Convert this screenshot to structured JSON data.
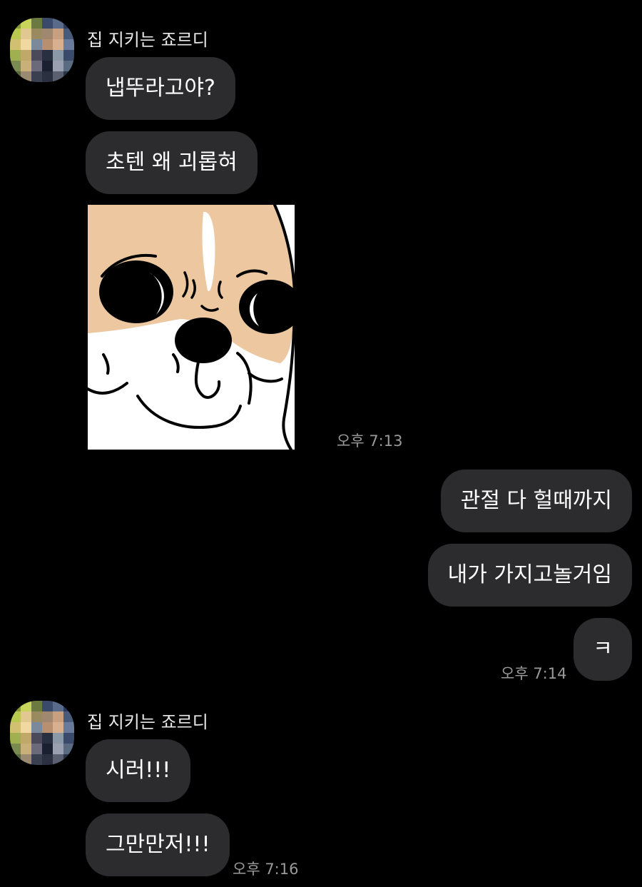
{
  "colors": {
    "background": "#000000",
    "bubble": "#2c2c2e",
    "text": "#ffffff",
    "timestamp": "#9a9a9a",
    "sticker_tan": "#ecc7a0"
  },
  "groups": [
    {
      "sender": "집 지키는 죠르디",
      "messages": [
        "냅뚜라고야?",
        "초텐 왜 괴롭혀"
      ],
      "sticker": "dog-face-sticker",
      "time": "오후 7:13"
    },
    {
      "messages": [
        "관절 다 헐때까지",
        "내가 가지고놀거임",
        "ㅋ"
      ],
      "time": "오후 7:14"
    },
    {
      "sender": "집 지키는 죠르디",
      "messages": [
        "시러!!!",
        "그만만저!!!"
      ],
      "time": "오후 7:16"
    }
  ]
}
